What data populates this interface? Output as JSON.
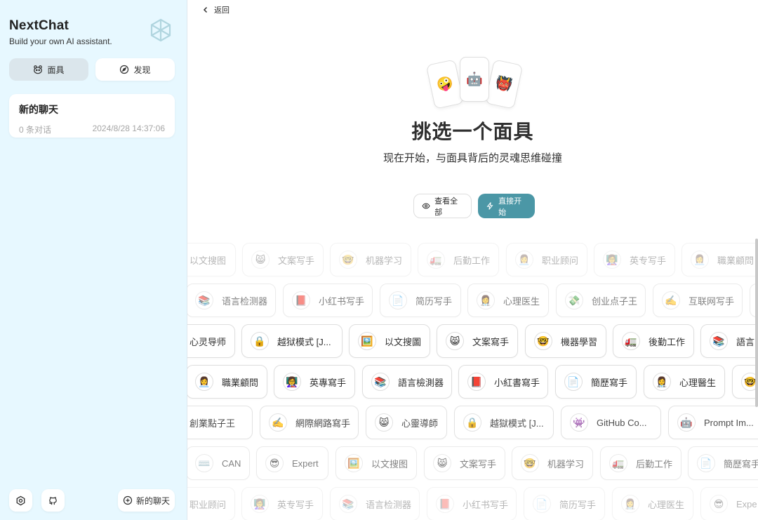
{
  "sidebar": {
    "title": "NextChat",
    "subtitle": "Build your own AI assistant.",
    "tabs": [
      {
        "label": "面具",
        "icon": "mask-icon",
        "active": true
      },
      {
        "label": "发现",
        "icon": "compass-icon",
        "active": false
      }
    ],
    "chat": {
      "title": "新的聊天",
      "count": "0 条对话",
      "time": "2024/8/28 14:37:06"
    },
    "new_chat_label": "新的聊天"
  },
  "main": {
    "back_label": "返回",
    "cards": [
      "🤪",
      "🤖",
      "👹"
    ],
    "title": "挑选一个面具",
    "subtitle": "现在开始，与面具背后的灵魂思维碰撞",
    "view_all_label": "查看全部",
    "start_label": "直接开始"
  },
  "rows": [
    {
      "items": [
        {
          "emoji": "",
          "name": "以文搜图"
        },
        {
          "emoji": "😸",
          "name": "文案写手"
        },
        {
          "emoji": "🤓",
          "name": "机器学习"
        },
        {
          "emoji": "🚛",
          "name": "后勤工作"
        },
        {
          "emoji": "👩‍💼",
          "name": "职业顾问"
        },
        {
          "emoji": "👩‍🏫",
          "name": "英专写手"
        },
        {
          "emoji": "👩‍💼",
          "name": "職業顧問"
        }
      ]
    },
    {
      "items": [
        {
          "emoji": "📚",
          "name": "语言检测器"
        },
        {
          "emoji": "📕",
          "name": "小红书写手"
        },
        {
          "emoji": "📄",
          "name": "简历写手"
        },
        {
          "emoji": "👩‍⚕️",
          "name": "心理医生"
        },
        {
          "emoji": "💸",
          "name": "创业点子王"
        },
        {
          "emoji": "✍️",
          "name": "互联网写手"
        }
      ]
    },
    {
      "items": [
        {
          "emoji": "",
          "name": "心灵导师"
        },
        {
          "emoji": "🔒",
          "name": "越狱模式 [J..."
        },
        {
          "emoji": "🖼️",
          "name": "以文搜圖"
        },
        {
          "emoji": "😸",
          "name": "文案寫手"
        },
        {
          "emoji": "🤓",
          "name": "機器學習"
        },
        {
          "emoji": "🚛",
          "name": "後勤工作"
        },
        {
          "emoji": "📚",
          "name": "語言"
        }
      ]
    },
    {
      "items": [
        {
          "emoji": "👩‍💼",
          "name": "職業顧問"
        },
        {
          "emoji": "👩‍🏫",
          "name": "英專寫手"
        },
        {
          "emoji": "📚",
          "name": "語言檢測器"
        },
        {
          "emoji": "📕",
          "name": "小紅書寫手"
        },
        {
          "emoji": "📄",
          "name": "簡歷寫手"
        },
        {
          "emoji": "👩‍⚕️",
          "name": "心理醫生"
        },
        {
          "emoji": "🤓",
          "name": ""
        }
      ]
    },
    {
      "items": [
        {
          "emoji": "",
          "name": "創業點子王"
        },
        {
          "emoji": "✍️",
          "name": "網際網路寫手"
        },
        {
          "emoji": "😸",
          "name": "心靈導師"
        },
        {
          "emoji": "🔒",
          "name": "越獄模式 [J..."
        },
        {
          "emoji": "👾",
          "name": "GitHub Co..."
        },
        {
          "emoji": "🤖",
          "name": "Prompt Im..."
        }
      ]
    },
    {
      "items": [
        {
          "emoji": "⌨️",
          "name": "CAN"
        },
        {
          "emoji": "😎",
          "name": "Expert"
        },
        {
          "emoji": "🖼️",
          "name": "以文搜图"
        },
        {
          "emoji": "😸",
          "name": "文案写手"
        },
        {
          "emoji": "🤓",
          "name": "机器学习"
        },
        {
          "emoji": "🚛",
          "name": "后勤工作"
        },
        {
          "emoji": "📄",
          "name": "簡歷寫手"
        }
      ]
    },
    {
      "items": [
        {
          "emoji": "",
          "name": "职业顾问"
        },
        {
          "emoji": "👩‍🏫",
          "name": "英专写手"
        },
        {
          "emoji": "📚",
          "name": "语言检测器"
        },
        {
          "emoji": "📕",
          "name": "小红书写手"
        },
        {
          "emoji": "📄",
          "name": "简历写手"
        },
        {
          "emoji": "👩‍⚕️",
          "name": "心理医生"
        },
        {
          "emoji": "😎",
          "name": "Expe"
        }
      ]
    }
  ]
}
